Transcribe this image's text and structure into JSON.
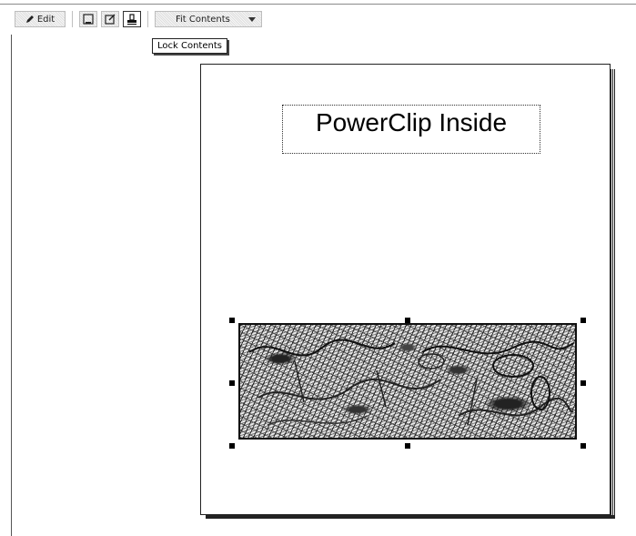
{
  "toolbar": {
    "edit_label": "Edit",
    "edit_icon": "pencil-icon",
    "extract_icon": "extract-contents-icon",
    "edit_contents_icon": "edit-contents-icon",
    "lock_icon": "lock-contents-icon",
    "fit_dropdown_label": "Fit Contents"
  },
  "tooltip": {
    "text": "Lock Contents"
  },
  "canvas": {
    "title_text": "PowerClip Inside"
  }
}
